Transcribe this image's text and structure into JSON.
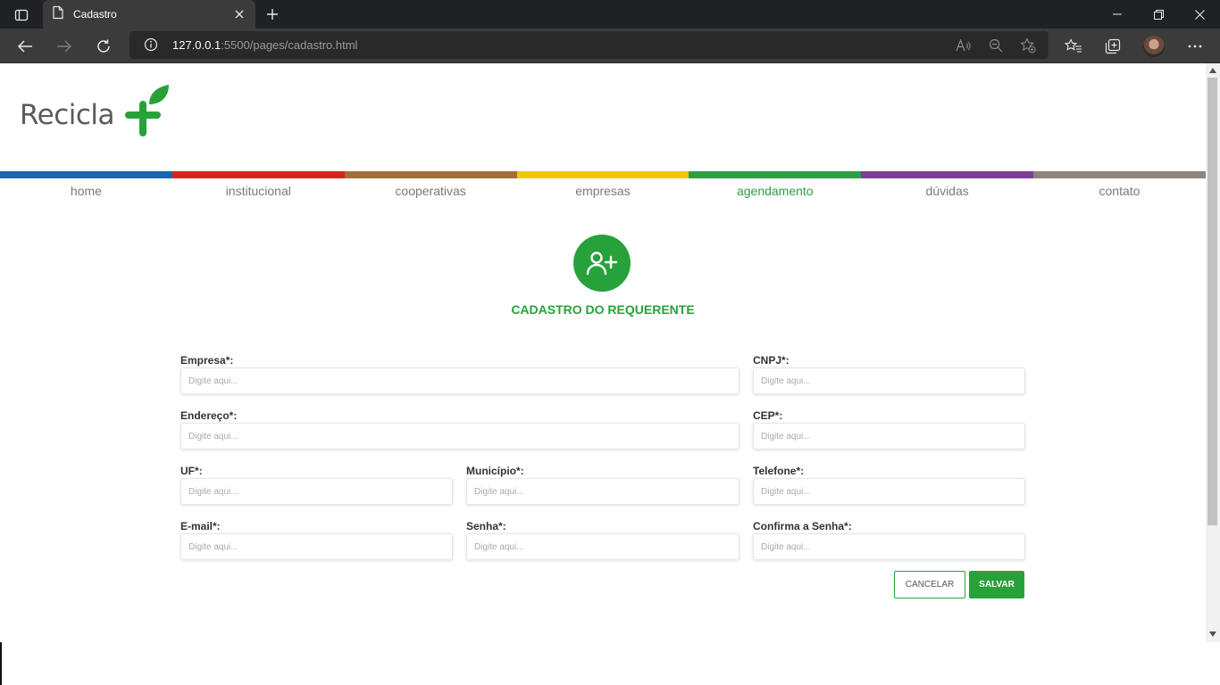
{
  "browser": {
    "tab_title": "Cadastro",
    "url_host": "127.0.0.1",
    "url_rest": ":5500/pages/cadastro.html",
    "icons": [
      "tab-list-icon",
      "page-icon",
      "close-icon",
      "plus-icon",
      "minimize-icon",
      "restore-icon",
      "back-icon",
      "forward-icon",
      "refresh-icon",
      "info-icon",
      "read-aloud-icon",
      "zoom-icon",
      "add-favorite-icon",
      "favorites-icon",
      "collections-icon",
      "profile-avatar",
      "more-icon"
    ]
  },
  "site": {
    "logo_text": "Recicla",
    "brand_color": "#27a23b"
  },
  "menu": {
    "items": [
      {
        "label": "home",
        "color": "#1565b0"
      },
      {
        "label": "institucional",
        "color": "#d9241c"
      },
      {
        "label": "cooperativas",
        "color": "#a0703a"
      },
      {
        "label": "empresas",
        "color": "#f2c700"
      },
      {
        "label": "agendamento",
        "color": "#2e9e45"
      },
      {
        "label": "dúvidas",
        "color": "#7b3f96"
      },
      {
        "label": "contato",
        "color": "#8f857d"
      }
    ],
    "active": "agendamento"
  },
  "form": {
    "title": "CADASTRO DO REQUERENTE",
    "fields": {
      "empresa": {
        "label": "Empresa*:",
        "placeholder": "Digite aqui..."
      },
      "cnpj": {
        "label": "CNPJ*:",
        "placeholder": "Digite aqui..."
      },
      "endereco": {
        "label": "Endereço*:",
        "placeholder": "Digite aqui..."
      },
      "cep": {
        "label": "CEP*:",
        "placeholder": "Digite aqui..."
      },
      "uf": {
        "label": "UF*:",
        "placeholder": "Digite aqui..."
      },
      "municipio": {
        "label": "Município*:",
        "placeholder": "Digite aqui..."
      },
      "telefone": {
        "label": "Telefone*:",
        "placeholder": "Digite aqui..."
      },
      "email": {
        "label": "E-mail*:",
        "placeholder": "Digite aqui..."
      },
      "senha": {
        "label": "Senha*:",
        "placeholder": "Digite aqui..."
      },
      "confirma": {
        "label": "Confirma a Senha*:",
        "placeholder": "Digite aqui..."
      }
    },
    "cancel_label": "CANCELAR",
    "save_label": "SALVAR"
  }
}
